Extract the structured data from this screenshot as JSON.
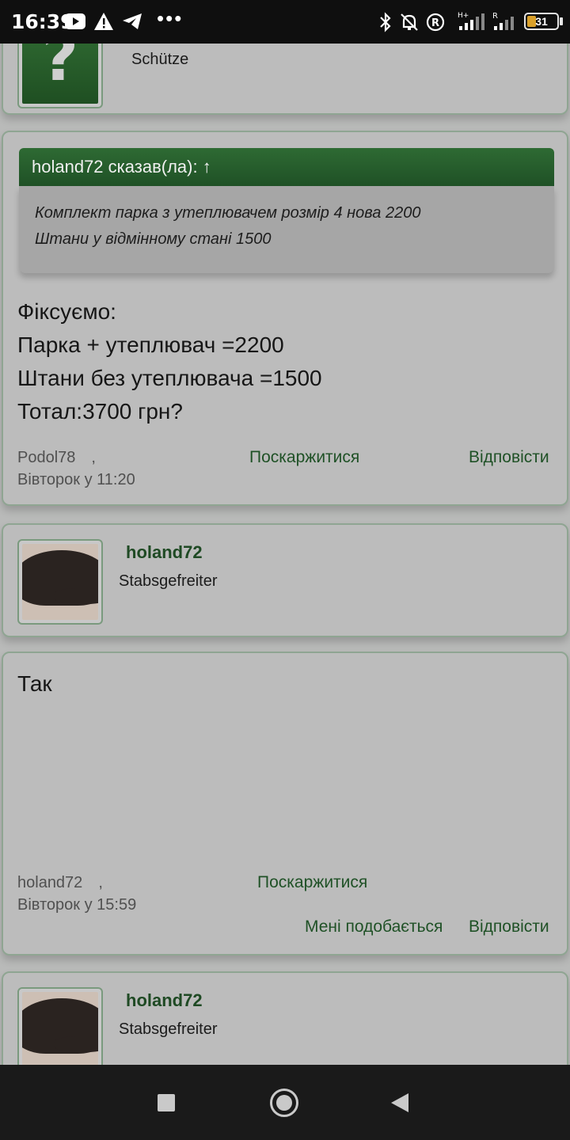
{
  "status_bar": {
    "time": "16:39",
    "battery": "31",
    "battery_level": 0.31,
    "left_icons": [
      "youtube-icon",
      "warning-icon",
      "telegram-icon",
      "more-dots-icon"
    ],
    "right_icons": [
      "bluetooth-icon",
      "bell-muted-icon",
      "registered-icon",
      "signal-hplus-icon",
      "signal-roaming-icon",
      "battery-icon"
    ],
    "dots": "•••"
  },
  "posts": [
    {
      "author_card": {
        "rank": "Schütze",
        "avatar": "question-mark-avatar"
      }
    },
    {
      "quote": {
        "header": "holand72 сказав(ла): ↑",
        "lines": [
          "Комплект парка з утеплювачем розмір 4 нова 2200",
          "Штани у відмінному стані 1500"
        ]
      },
      "body_lines": [
        "Фіксуємо:",
        "Парка + утеплювач =2200",
        "Штани без утеплювача =1500",
        "Тотал:3700 грн?"
      ],
      "author": "Podol78",
      "sep": ",",
      "date": "Вівторок у 11:20",
      "report": "Поскаржитися",
      "reply": "Відповісти"
    },
    {
      "author_card": {
        "username": "holand72",
        "rank": "Stabsgefreiter",
        "avatar": "hat-photo-avatar"
      }
    },
    {
      "body_lines": [
        "Так"
      ],
      "author": "holand72",
      "sep": ",",
      "date": "Вівторок у 15:59",
      "report": "Поскаржитися",
      "like": "Мені подобається",
      "reply": "Відповісти"
    },
    {
      "author_card": {
        "username": "holand72",
        "rank": "Stabsgefreiter",
        "avatar": "hat-photo-avatar"
      }
    }
  ],
  "nav": {
    "recents": "recents-square-icon",
    "home": "home-circle-icon",
    "back": "back-triangle-icon"
  }
}
